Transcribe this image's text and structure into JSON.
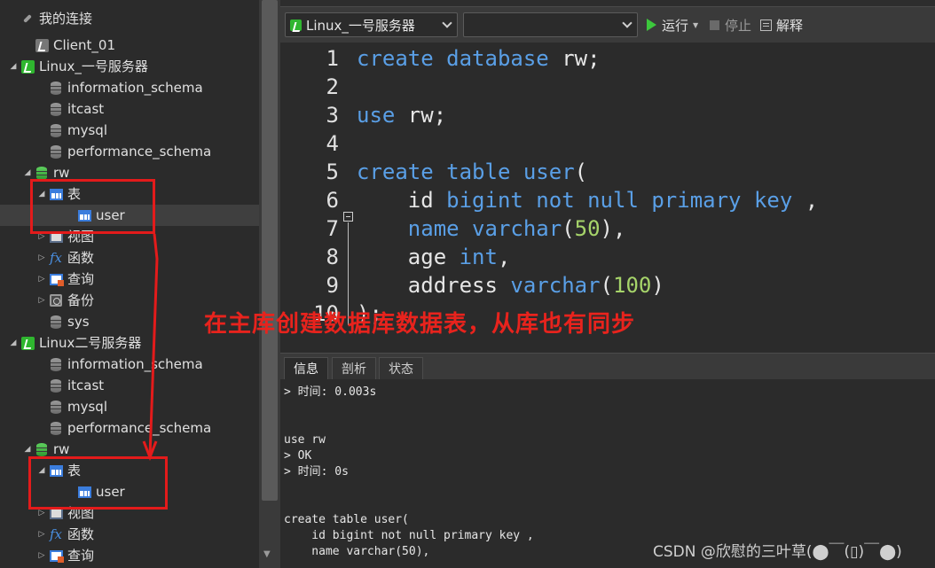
{
  "navigator": {
    "items": [
      {
        "label": "我的连接",
        "icon": "link-icon",
        "twisty": ""
      },
      {
        "label": "Client_01",
        "icon": "connection-gray-icon",
        "twisty": ""
      },
      {
        "label": "Linux_一号服务器",
        "icon": "connection-icon",
        "twisty": "◢"
      },
      {
        "label": "information_schema",
        "icon": "database-icon",
        "twisty": ""
      },
      {
        "label": "itcast",
        "icon": "database-icon",
        "twisty": ""
      },
      {
        "label": "mysql",
        "icon": "database-icon",
        "twisty": ""
      },
      {
        "label": "performance_schema",
        "icon": "database-icon",
        "twisty": ""
      },
      {
        "label": "rw",
        "icon": "database-open-icon",
        "twisty": "◢"
      },
      {
        "label": "表",
        "icon": "table-icon",
        "twisty": "◢"
      },
      {
        "label": "user",
        "icon": "table-icon",
        "twisty": ""
      },
      {
        "label": "视图",
        "icon": "view-icon",
        "twisty": "▷"
      },
      {
        "label": "函数",
        "icon": "function-icon",
        "twisty": "▷"
      },
      {
        "label": "查询",
        "icon": "query-icon",
        "twisty": "▷"
      },
      {
        "label": "备份",
        "icon": "backup-icon",
        "twisty": "▷"
      },
      {
        "label": "sys",
        "icon": "database-icon",
        "twisty": ""
      },
      {
        "label": "Linux二号服务器",
        "icon": "connection-icon",
        "twisty": "◢"
      },
      {
        "label": "information_schema",
        "icon": "database-icon",
        "twisty": ""
      },
      {
        "label": "itcast",
        "icon": "database-icon",
        "twisty": ""
      },
      {
        "label": "mysql",
        "icon": "database-icon",
        "twisty": ""
      },
      {
        "label": "performance_schema",
        "icon": "database-icon",
        "twisty": ""
      },
      {
        "label": "rw",
        "icon": "database-open-icon",
        "twisty": "◢"
      },
      {
        "label": "表",
        "icon": "table-icon",
        "twisty": "◢"
      },
      {
        "label": "user",
        "icon": "table-icon",
        "twisty": ""
      },
      {
        "label": "视图",
        "icon": "view-icon",
        "twisty": "▷"
      },
      {
        "label": "函数",
        "icon": "function-icon",
        "twisty": "▷"
      },
      {
        "label": "查询",
        "icon": "query-icon",
        "twisty": "▷"
      }
    ]
  },
  "toolbar": {
    "connection_select": "Linux_一号服务器",
    "database_select": "",
    "run_label": "运行",
    "stop_label": "停止",
    "explain_label": "解释"
  },
  "editor": {
    "lines": [
      {
        "n": "1",
        "tokens": [
          [
            "kw",
            "create database"
          ],
          [
            "t",
            " rw;"
          ]
        ]
      },
      {
        "n": "2",
        "tokens": []
      },
      {
        "n": "3",
        "tokens": [
          [
            "kw",
            "use"
          ],
          [
            "t",
            " rw;"
          ]
        ]
      },
      {
        "n": "4",
        "tokens": []
      },
      {
        "n": "5",
        "tokens": [
          [
            "kw",
            "create table user"
          ],
          [
            "t",
            "("
          ]
        ]
      },
      {
        "n": "6",
        "tokens": [
          [
            "t",
            "    id "
          ],
          [
            "kw",
            "bigint not null primary key"
          ],
          [
            "t",
            " ,"
          ]
        ]
      },
      {
        "n": "7",
        "tokens": [
          [
            "t",
            "    "
          ],
          [
            "kw",
            "name varchar"
          ],
          [
            "t",
            "("
          ],
          [
            "num",
            "50"
          ],
          [
            "t",
            "),"
          ]
        ]
      },
      {
        "n": "8",
        "tokens": [
          [
            "t",
            "    age "
          ],
          [
            "kw",
            "int"
          ],
          [
            "t",
            ","
          ]
        ]
      },
      {
        "n": "9",
        "tokens": [
          [
            "t",
            "    address "
          ],
          [
            "kw",
            "varchar"
          ],
          [
            "t",
            "("
          ],
          [
            "num",
            "100"
          ],
          [
            "t",
            ")"
          ]
        ]
      },
      {
        "n": "10",
        "tokens": [
          [
            "t",
            ");"
          ]
        ]
      }
    ]
  },
  "output": {
    "tabs": [
      "信息",
      "剖析",
      "状态"
    ],
    "lines": [
      "> 时间: 0.003s",
      "",
      "",
      "use rw",
      "> OK",
      "> 时间: 0s",
      "",
      "",
      "create table user(",
      "    id bigint not null primary key ,",
      "    name varchar(50),"
    ]
  },
  "annotation": {
    "text": "在主库创建数据库数据表，从库也有同步",
    "color": "#e8231d"
  },
  "watermark": "CSDN @欣慰的三叶草(⬤￣(▯)￣⬤)"
}
